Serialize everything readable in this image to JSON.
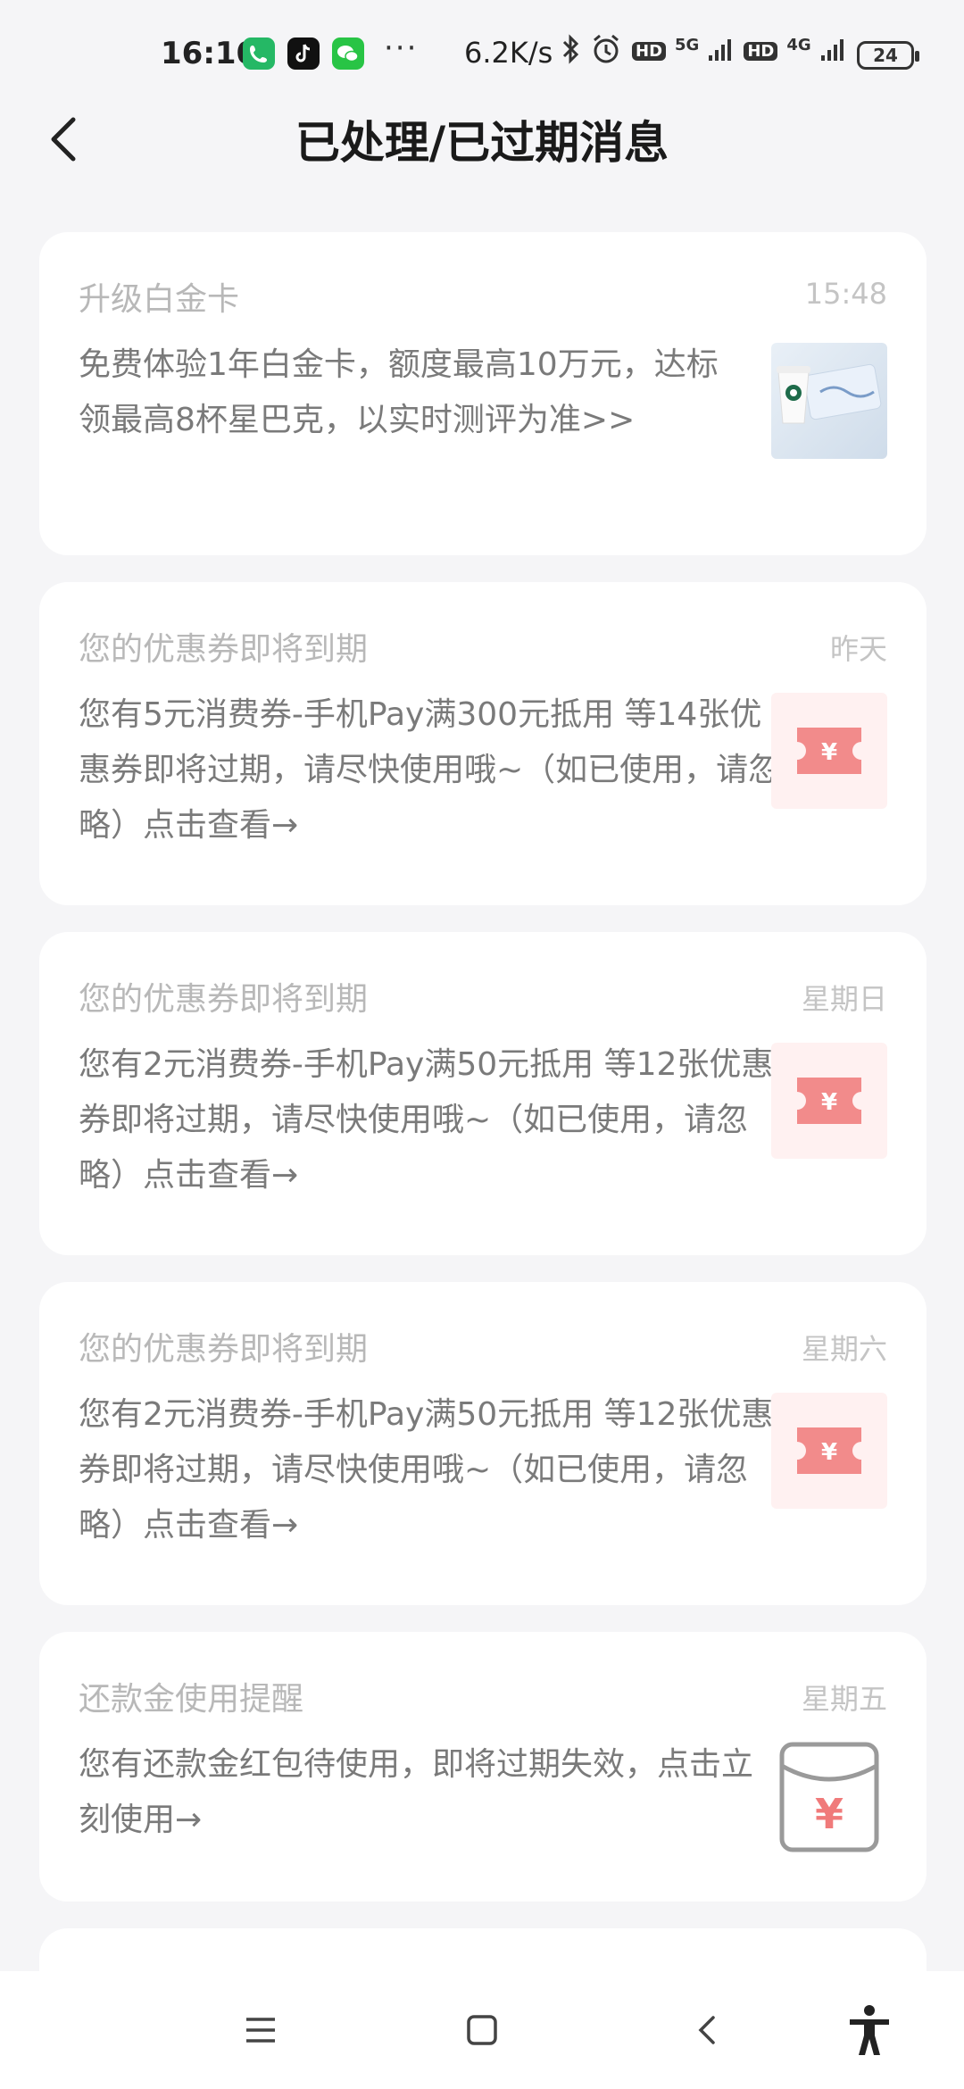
{
  "status_bar": {
    "time": "16:10",
    "dots": "···",
    "net_speed": "6.2K/s",
    "hd1": "HD",
    "sig1": "5G",
    "hd2": "HD",
    "sig2": "4G",
    "battery": "24"
  },
  "header": {
    "title": "已处理/已过期消息"
  },
  "messages": [
    {
      "title": "升级白金卡",
      "time": "15:48",
      "body": "免费体验1年白金卡，额度最高10万元，达标领最高8杯星巴克，以实时测评为准>>",
      "thumb_icon": "starbucks-card-image"
    },
    {
      "title": "您的优惠券即将到期",
      "time": "昨天",
      "body": "您有5元消费券-手机Pay满300元抵用 等14张优惠券即将过期，请尽快使用哦~（如已使用，请忽略）点击查看→",
      "thumb_icon": "coupon-icon",
      "thumb_glyph": "¥"
    },
    {
      "title": "您的优惠券即将到期",
      "time": "星期日",
      "body": "您有2元消费券-手机Pay满50元抵用 等12张优惠券即将过期，请尽快使用哦~（如已使用，请忽略）点击查看→",
      "thumb_icon": "coupon-icon",
      "thumb_glyph": "¥"
    },
    {
      "title": "您的优惠券即将到期",
      "time": "星期六",
      "body": "您有2元消费券-手机Pay满50元抵用 等12张优惠券即将过期，请尽快使用哦~（如已使用，请忽略）点击查看→",
      "thumb_icon": "coupon-icon",
      "thumb_glyph": "¥"
    },
    {
      "title": "还款金使用提醒",
      "time": "星期五",
      "body": "您有还款金红包待使用，即将过期失效，点击立刻使用→",
      "thumb_icon": "red-envelope-icon",
      "thumb_glyph": "¥"
    }
  ],
  "colors": {
    "background": "#f5f5f7",
    "card": "#ffffff",
    "coupon_red": "#f28b8b",
    "coupon_bg": "#fff1f1"
  }
}
